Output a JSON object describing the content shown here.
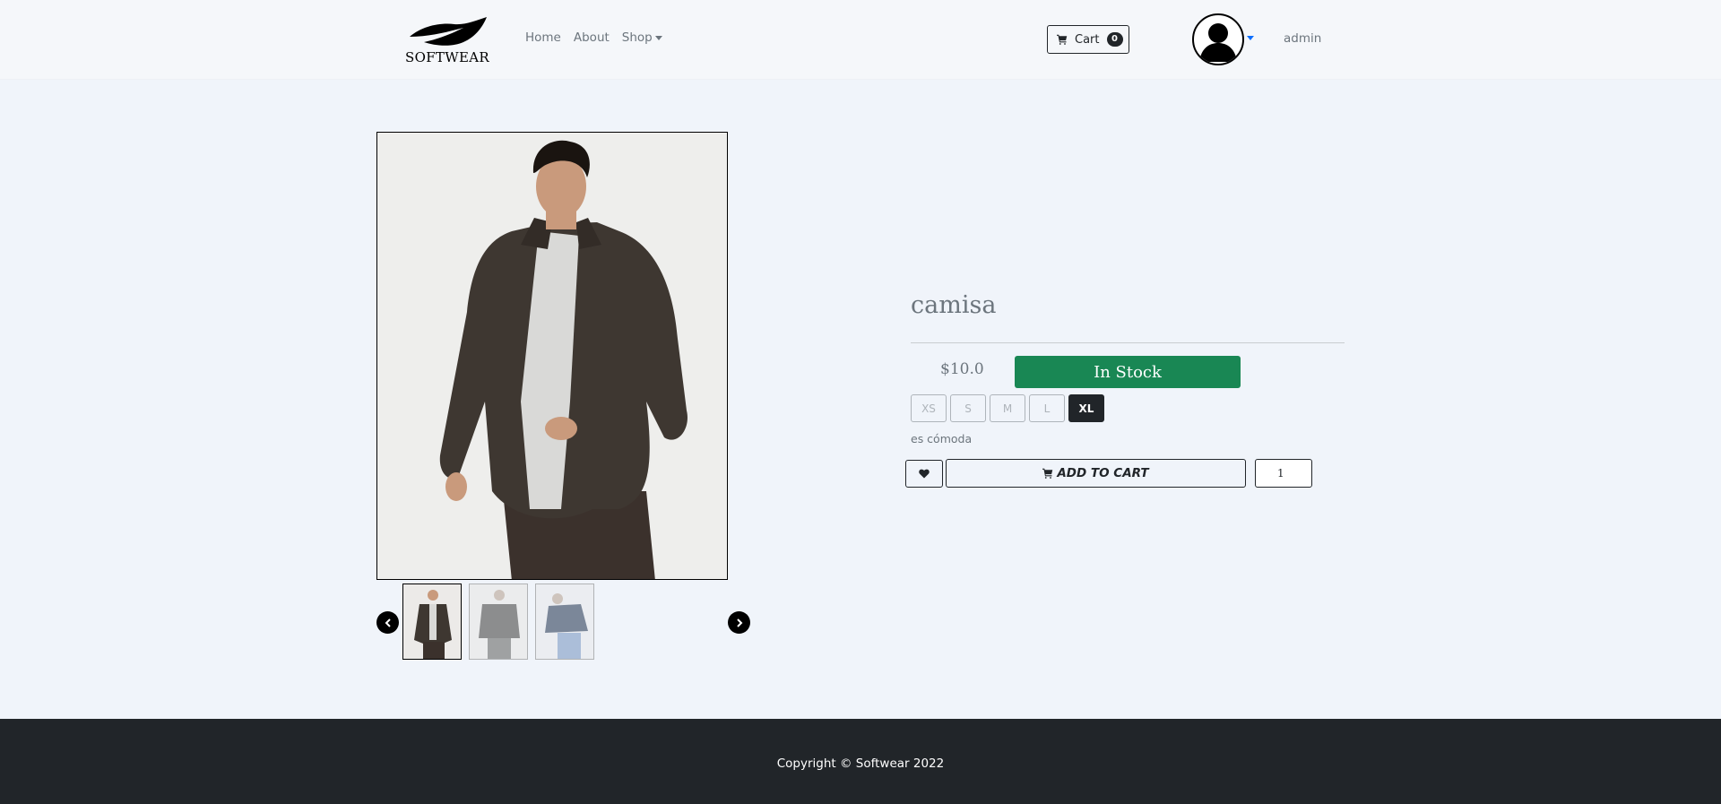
{
  "brand": {
    "name": "SOFTWEAR"
  },
  "nav": {
    "links": [
      "Home",
      "About",
      "Shop"
    ]
  },
  "cart": {
    "label": "Cart",
    "count": "0"
  },
  "user": {
    "name": "admin"
  },
  "product": {
    "title": "camisa",
    "price": "$10.0",
    "stock_status": "In Stock",
    "sizes": [
      "XS",
      "S",
      "M",
      "L",
      "XL"
    ],
    "selected_size": "XL",
    "description": "es cómoda",
    "add_to_cart_label": "ADD TO CART",
    "quantity": "1"
  },
  "footer": {
    "copyright": "Copyright © Softwear 2022"
  },
  "colors": {
    "stock_green": "#198754",
    "dark": "#212529",
    "accent_caret": "#0d6efd"
  }
}
